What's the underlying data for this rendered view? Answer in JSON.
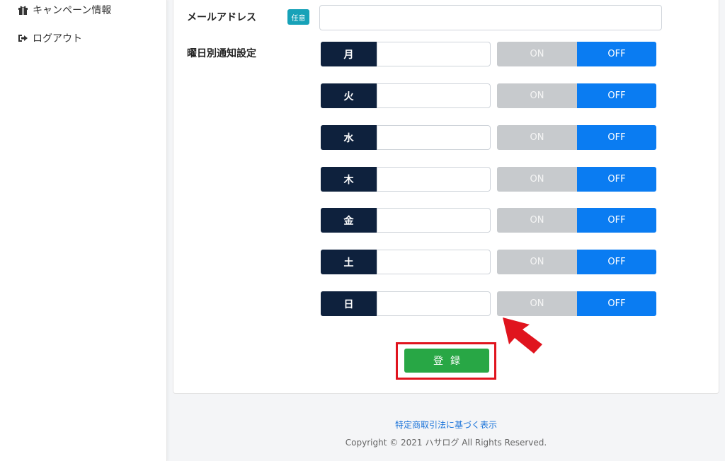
{
  "sidebar": {
    "items": [
      {
        "label": "キャンペーン情報",
        "icon": "gift-icon"
      },
      {
        "label": "ログアウト",
        "icon": "sign-out-icon"
      }
    ]
  },
  "form": {
    "email_label": "メールアドレス",
    "optional_badge": "任意",
    "email_value": "",
    "weekday_label": "曜日別通知設定",
    "days": [
      {
        "day": "月",
        "value": "",
        "on_label": "ON",
        "off_label": "OFF",
        "selected": "OFF"
      },
      {
        "day": "火",
        "value": "",
        "on_label": "ON",
        "off_label": "OFF",
        "selected": "OFF"
      },
      {
        "day": "水",
        "value": "",
        "on_label": "ON",
        "off_label": "OFF",
        "selected": "OFF"
      },
      {
        "day": "木",
        "value": "",
        "on_label": "ON",
        "off_label": "OFF",
        "selected": "OFF"
      },
      {
        "day": "金",
        "value": "",
        "on_label": "ON",
        "off_label": "OFF",
        "selected": "OFF"
      },
      {
        "day": "土",
        "value": "",
        "on_label": "ON",
        "off_label": "OFF",
        "selected": "OFF"
      },
      {
        "day": "日",
        "value": "",
        "on_label": "ON",
        "off_label": "OFF",
        "selected": "OFF"
      }
    ],
    "submit_label": "登録"
  },
  "footer": {
    "link_label": "特定商取引法に基づく表示",
    "copyright": "Copyright © 2021 ハサログ All Rights Reserved."
  },
  "colors": {
    "day_box": "#0e213d",
    "toggle_off_active": "#0a7cf2",
    "toggle_on_inactive": "#c7cacd",
    "submit": "#28a745",
    "highlight": "#e0141e",
    "badge": "#17a2b8"
  }
}
